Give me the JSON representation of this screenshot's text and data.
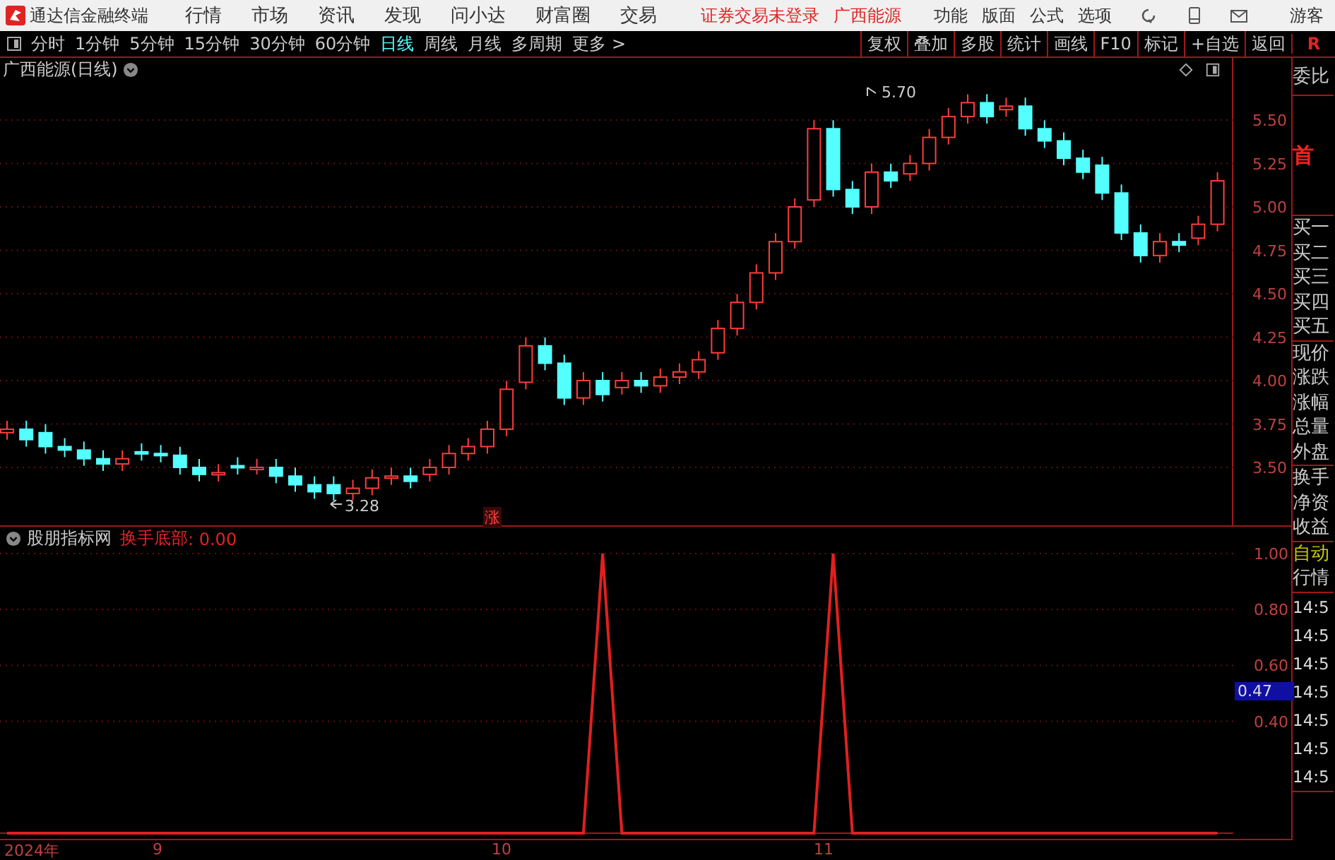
{
  "menu_bar": {
    "app_title": "通达信金融终端",
    "menus": [
      "行情",
      "市场",
      "资讯",
      "发现",
      "问小达",
      "财富圈",
      "交易"
    ],
    "notice": "证券交易未登录",
    "stock": "广西能源",
    "tools": [
      "功能",
      "版面",
      "公式",
      "选项"
    ],
    "user": "游客"
  },
  "period_bar": {
    "periods": [
      {
        "label": "分时",
        "selected": false
      },
      {
        "label": "1分钟",
        "selected": false
      },
      {
        "label": "5分钟",
        "selected": false
      },
      {
        "label": "15分钟",
        "selected": false
      },
      {
        "label": "30分钟",
        "selected": false
      },
      {
        "label": "60分钟",
        "selected": false
      },
      {
        "label": "日线",
        "selected": true
      },
      {
        "label": "周线",
        "selected": false
      },
      {
        "label": "月线",
        "selected": false
      },
      {
        "label": "多周期",
        "selected": false
      },
      {
        "label": "更多 >",
        "selected": false
      }
    ],
    "actions": [
      "复权",
      "叠加",
      "多股",
      "统计",
      "画线",
      "F10",
      "标记",
      "+自选",
      "返回"
    ],
    "side_tab": "R"
  },
  "price_chart": {
    "title": "广西能源(日线)",
    "y_labels": [
      "5.50",
      "5.25",
      "5.00",
      "4.75",
      "4.50",
      "4.25",
      "4.00",
      "3.75",
      "3.50"
    ],
    "high_label": "5.70",
    "low_label": "3.28",
    "marker": "涨"
  },
  "indicator": {
    "name": "股朋指标网",
    "reading": ": 0.00",
    "cursor_value": "0.47",
    "chart_data": {
      "type": "line",
      "grid": true,
      "ylim": [
        0,
        1
      ],
      "yticks": [
        {
          "value": 0.4,
          "label": "0.40"
        },
        {
          "value": 0.6,
          "label": "0.60"
        },
        {
          "value": 0.8,
          "label": "0.80"
        },
        {
          "value": 1.0,
          "label": "1.00"
        }
      ],
      "series": [
        {
          "name": "换手底部",
          "color": "#e02020",
          "values": [
            0,
            0,
            0,
            0,
            0,
            0,
            0,
            0,
            0,
            0,
            0,
            0,
            0,
            0,
            0,
            0,
            0,
            0,
            0,
            0,
            0,
            0,
            0,
            0,
            0,
            0,
            0,
            0,
            0,
            0,
            0,
            1,
            0,
            0,
            0,
            0,
            0,
            0,
            0,
            0,
            0,
            0,
            0,
            1,
            0,
            0,
            0,
            0,
            0,
            0,
            0,
            0,
            0,
            0,
            0,
            0,
            0,
            0,
            0,
            0,
            0,
            0,
            0,
            0
          ]
        }
      ]
    }
  },
  "date_axis": [
    "2024年",
    "9",
    "10",
    "11"
  ],
  "quote_panel": {
    "top": "委比",
    "badge": "首",
    "groups": [
      [
        "买一",
        "买二",
        "买三",
        "买四",
        "买五"
      ],
      [
        "现价",
        "涨跌",
        "涨幅",
        "总量",
        "外盘"
      ],
      [
        "换手",
        "净资",
        "收益"
      ]
    ],
    "mode": [
      "自动",
      "行情"
    ],
    "times": [
      "14:5",
      "14:5",
      "14:5",
      "14:5",
      "14:5",
      "14:5",
      "14:5"
    ]
  }
}
